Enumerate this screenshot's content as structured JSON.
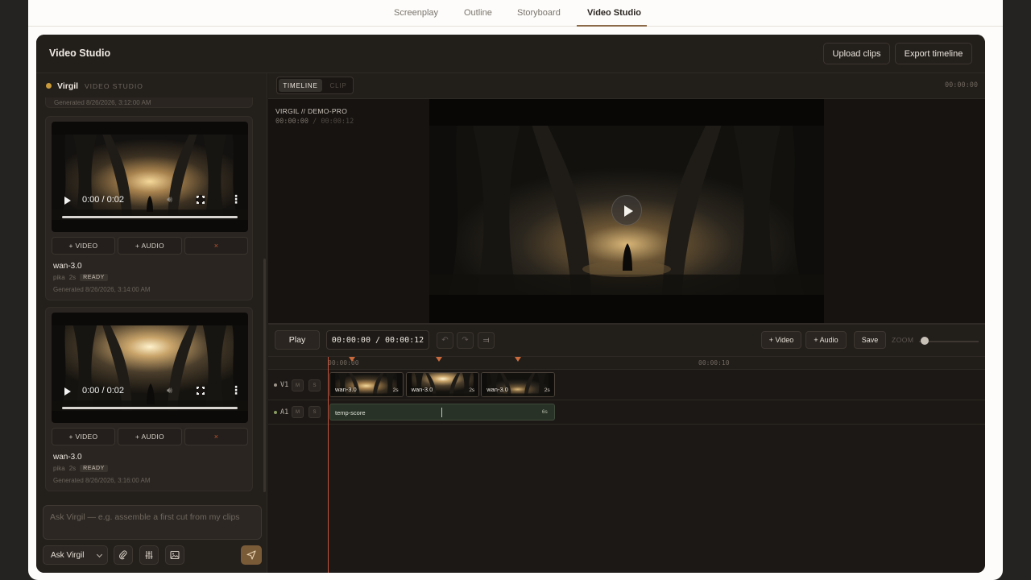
{
  "nav": {
    "tabs": [
      {
        "label": "Screenplay"
      },
      {
        "label": "Outline"
      },
      {
        "label": "Storyboard"
      },
      {
        "label": "Video Studio",
        "active": true
      }
    ]
  },
  "studio": {
    "title": "Video Studio",
    "upload_label": "Upload clips",
    "export_label": "Export timeline"
  },
  "assistant": {
    "name": "Virgil",
    "subtitle": "VIDEO STUDIO",
    "status_color": "#c89a3c"
  },
  "clips": {
    "previous_generated": "Generated 8/26/2026, 3:12:00 AM",
    "items": [
      {
        "name": "wan-3.0",
        "provider": "pika",
        "duration": "2s",
        "status": "READY",
        "generated": "Generated 8/26/2026, 3:14:00 AM",
        "player_time": "0:00 / 0:02",
        "add_video_label": "+ VIDEO",
        "add_audio_label": "+ AUDIO",
        "remove_label": "×"
      },
      {
        "name": "wan-3.0",
        "provider": "pika",
        "duration": "2s",
        "status": "READY",
        "generated": "Generated 8/26/2026, 3:16:00 AM",
        "player_time": "0:00 / 0:02",
        "add_video_label": "+ VIDEO",
        "add_audio_label": "+ AUDIO",
        "remove_label": "×"
      }
    ]
  },
  "chat": {
    "placeholder": "Ask Virgil — e.g. assemble a first cut from my clips",
    "mode_label": "Ask Virgil",
    "icons": [
      "paperclip-icon",
      "sliders-icon",
      "image-icon",
      "send-icon"
    ]
  },
  "viewer": {
    "mode_timeline": "TIMELINE",
    "mode_clip": "CLIP",
    "header_timecode": "00:00:00",
    "project_label": "VIRGIL // DEMO-PRO",
    "current_time": "00:00:00",
    "time_separator": "/",
    "total_time": "00:00:12"
  },
  "timeline": {
    "play_label": "Play",
    "timecode": "00:00:00 / 00:00:12",
    "add_video_label": "+ Video",
    "add_audio_label": "+ Audio",
    "save_label": "Save",
    "zoom_label": "ZOOM",
    "zoom_level": 0.05,
    "ruler": [
      "00:00:00",
      "00:00:10"
    ],
    "tracks": {
      "video": {
        "name": "V1",
        "mute": "M",
        "solo": "S",
        "dot_color": "#9d958b",
        "clips": [
          {
            "name": "wan-3.0",
            "duration": "2s",
            "start": 0,
            "length": 2
          },
          {
            "name": "wan-3.0",
            "duration": "2s",
            "start": 2,
            "length": 2
          },
          {
            "name": "wan-3.0",
            "duration": "2s",
            "start": 4,
            "length": 2
          }
        ]
      },
      "audio": {
        "name": "A1",
        "mute": "M",
        "solo": "S",
        "dot_color": "#8a9c62",
        "clip": {
          "name": "temp-score",
          "duration": "6s",
          "start": 0,
          "length": 6
        }
      }
    },
    "markers": [
      0.6,
      2.9,
      5.0
    ],
    "playhead": 0
  }
}
